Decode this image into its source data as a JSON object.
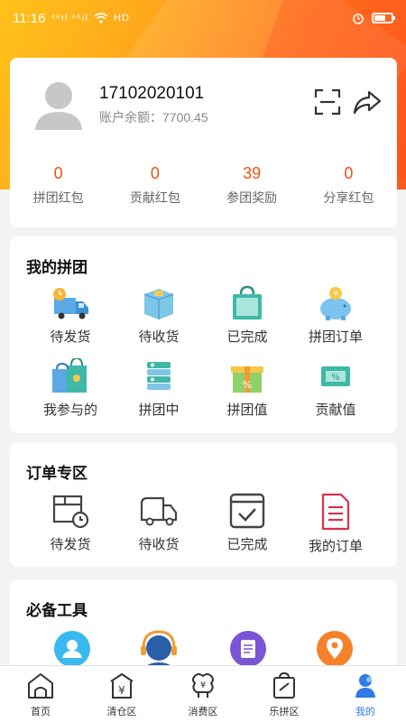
{
  "status_bar": {
    "time": "11:16",
    "signal": "⁴⁶ıl ⁴⁶ıl",
    "network": "HD"
  },
  "colors": {
    "accent": "#f05014",
    "nav_active": "#2f7ae5",
    "hero_start": "#ffc21a",
    "hero_end": "#ff5a1f"
  },
  "profile": {
    "phone": "17102020101",
    "balance": "账户余额：7700.45",
    "stats": [
      {
        "value": "0",
        "label": "拼团红包"
      },
      {
        "value": "0",
        "label": "贡献红包"
      },
      {
        "value": "39",
        "label": "参团奖励"
      },
      {
        "value": "0",
        "label": "分享红包"
      }
    ]
  },
  "pin": {
    "title": "我的拼团",
    "items": [
      {
        "label": "待发货",
        "icon": "delivery-truck-icon"
      },
      {
        "label": "待收货",
        "icon": "package-box-icon"
      },
      {
        "label": "已完成",
        "icon": "shopping-bag-icon"
      },
      {
        "label": "拼团订单",
        "icon": "piggy-bank-icon"
      },
      {
        "label": "我参与的",
        "icon": "gift-bags-icon"
      },
      {
        "label": "拼团中",
        "icon": "coin-stack-icon"
      },
      {
        "label": "拼团值",
        "icon": "gift-box-icon"
      },
      {
        "label": "贡献值",
        "icon": "percent-ticket-icon"
      }
    ]
  },
  "orders": {
    "title": "订单专区",
    "items": [
      {
        "label": "待发货",
        "icon": "box-clock-icon"
      },
      {
        "label": "待收货",
        "icon": "truck-outline-icon"
      },
      {
        "label": "已完成",
        "icon": "checkbox-icon"
      },
      {
        "label": "我的订单",
        "icon": "document-icon"
      }
    ]
  },
  "tools": {
    "title": "必备工具",
    "items": [
      {
        "icon": "user-profile-icon"
      },
      {
        "icon": "customer-service-icon"
      },
      {
        "icon": "notes-icon"
      },
      {
        "icon": "location-icon"
      }
    ]
  },
  "nav": {
    "items": [
      {
        "label": "首页",
        "icon": "home-icon"
      },
      {
        "label": "清仓区",
        "icon": "clearance-icon"
      },
      {
        "label": "消费区",
        "icon": "consume-icon"
      },
      {
        "label": "乐拼区",
        "icon": "group-buy-icon"
      },
      {
        "label": "我的",
        "icon": "profile-icon"
      }
    ]
  }
}
